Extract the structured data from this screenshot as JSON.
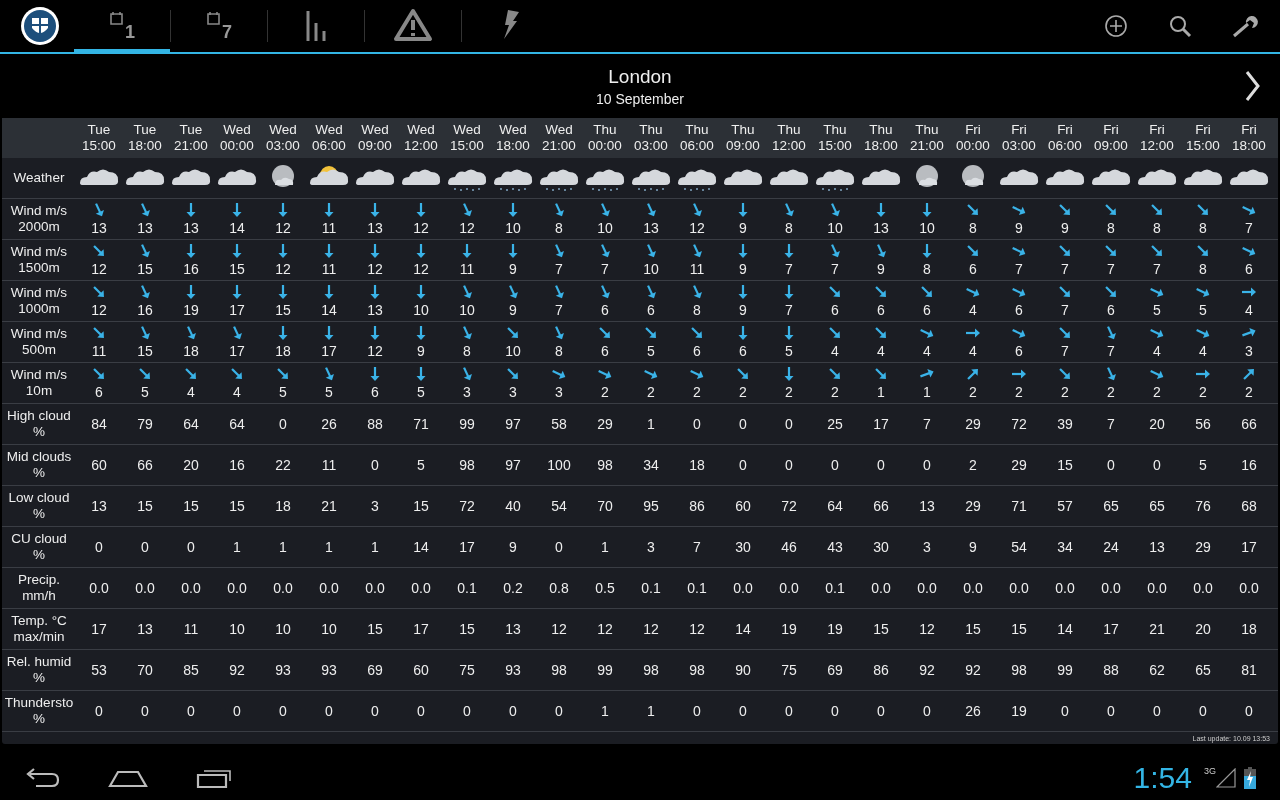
{
  "tabs": [
    {
      "kind": "day",
      "label": "1",
      "selected": true
    },
    {
      "kind": "day",
      "label": "7",
      "selected": false
    },
    {
      "kind": "chart",
      "selected": false
    },
    {
      "kind": "warning",
      "selected": false
    },
    {
      "kind": "lightning",
      "selected": false
    }
  ],
  "location": {
    "city": "London",
    "date": "10 September"
  },
  "columns": [
    {
      "day": "Tue",
      "time": "15:00"
    },
    {
      "day": "Tue",
      "time": "18:00"
    },
    {
      "day": "Tue",
      "time": "21:00"
    },
    {
      "day": "Wed",
      "time": "00:00"
    },
    {
      "day": "Wed",
      "time": "03:00"
    },
    {
      "day": "Wed",
      "time": "06:00"
    },
    {
      "day": "Wed",
      "time": "09:00"
    },
    {
      "day": "Wed",
      "time": "12:00"
    },
    {
      "day": "Wed",
      "time": "15:00"
    },
    {
      "day": "Wed",
      "time": "18:00"
    },
    {
      "day": "Wed",
      "time": "21:00"
    },
    {
      "day": "Thu",
      "time": "00:00"
    },
    {
      "day": "Thu",
      "time": "03:00"
    },
    {
      "day": "Thu",
      "time": "06:00"
    },
    {
      "day": "Thu",
      "time": "09:00"
    },
    {
      "day": "Thu",
      "time": "12:00"
    },
    {
      "day": "Thu",
      "time": "15:00"
    },
    {
      "day": "Thu",
      "time": "18:00"
    },
    {
      "day": "Thu",
      "time": "21:00"
    },
    {
      "day": "Fri",
      "time": "00:00"
    },
    {
      "day": "Fri",
      "time": "03:00"
    },
    {
      "day": "Fri",
      "time": "06:00"
    },
    {
      "day": "Fri",
      "time": "09:00"
    },
    {
      "day": "Fri",
      "time": "12:00"
    },
    {
      "day": "Fri",
      "time": "15:00"
    },
    {
      "day": "Fri",
      "time": "18:00"
    }
  ],
  "rows": [
    {
      "kind": "weather",
      "label": [
        "Weather"
      ],
      "cells": [
        {
          "kind": "cloudy"
        },
        {
          "kind": "cloudy"
        },
        {
          "kind": "cloudy"
        },
        {
          "kind": "cloudy"
        },
        {
          "kind": "night"
        },
        {
          "kind": "sun"
        },
        {
          "kind": "cloudy"
        },
        {
          "kind": "cloudy"
        },
        {
          "kind": "rain"
        },
        {
          "kind": "rain"
        },
        {
          "kind": "rain"
        },
        {
          "kind": "rain"
        },
        {
          "kind": "rain"
        },
        {
          "kind": "rain"
        },
        {
          "kind": "cloudy"
        },
        {
          "kind": "cloudy"
        },
        {
          "kind": "rain"
        },
        {
          "kind": "cloudy"
        },
        {
          "kind": "night"
        },
        {
          "kind": "night"
        },
        {
          "kind": "cloudy"
        },
        {
          "kind": "cloudy"
        },
        {
          "kind": "cloudy"
        },
        {
          "kind": "cloudy"
        },
        {
          "kind": "cloudy"
        },
        {
          "kind": "cloudy"
        }
      ]
    },
    {
      "kind": "wind",
      "label": [
        "Wind m/s",
        "2000m"
      ],
      "cells": [
        {
          "kind": "sse",
          "value": "13"
        },
        {
          "kind": "sse",
          "value": "13"
        },
        {
          "kind": "s",
          "value": "13"
        },
        {
          "kind": "s",
          "value": "14"
        },
        {
          "kind": "s",
          "value": "12"
        },
        {
          "kind": "s",
          "value": "11"
        },
        {
          "kind": "s",
          "value": "13"
        },
        {
          "kind": "s",
          "value": "12"
        },
        {
          "kind": "sse",
          "value": "12"
        },
        {
          "kind": "s",
          "value": "10"
        },
        {
          "kind": "sse",
          "value": "8"
        },
        {
          "kind": "sse",
          "value": "10"
        },
        {
          "kind": "sse",
          "value": "13"
        },
        {
          "kind": "sse",
          "value": "12"
        },
        {
          "kind": "s",
          "value": "9"
        },
        {
          "kind": "sse",
          "value": "8"
        },
        {
          "kind": "sse",
          "value": "10"
        },
        {
          "kind": "s",
          "value": "13"
        },
        {
          "kind": "s",
          "value": "10"
        },
        {
          "kind": "se",
          "value": "8"
        },
        {
          "kind": "ese",
          "value": "9"
        },
        {
          "kind": "se",
          "value": "9"
        },
        {
          "kind": "se",
          "value": "8"
        },
        {
          "kind": "se",
          "value": "8"
        },
        {
          "kind": "se",
          "value": "8"
        },
        {
          "kind": "ese",
          "value": "7"
        }
      ]
    },
    {
      "kind": "wind",
      "label": [
        "Wind m/s",
        "1500m"
      ],
      "cells": [
        {
          "kind": "se",
          "value": "12"
        },
        {
          "kind": "sse",
          "value": "15"
        },
        {
          "kind": "s",
          "value": "16"
        },
        {
          "kind": "s",
          "value": "15"
        },
        {
          "kind": "s",
          "value": "12"
        },
        {
          "kind": "s",
          "value": "11"
        },
        {
          "kind": "s",
          "value": "12"
        },
        {
          "kind": "s",
          "value": "12"
        },
        {
          "kind": "s",
          "value": "11"
        },
        {
          "kind": "s",
          "value": "9"
        },
        {
          "kind": "sse",
          "value": "7"
        },
        {
          "kind": "sse",
          "value": "7"
        },
        {
          "kind": "sse",
          "value": "10"
        },
        {
          "kind": "sse",
          "value": "11"
        },
        {
          "kind": "s",
          "value": "9"
        },
        {
          "kind": "s",
          "value": "7"
        },
        {
          "kind": "sse",
          "value": "7"
        },
        {
          "kind": "sse",
          "value": "9"
        },
        {
          "kind": "s",
          "value": "8"
        },
        {
          "kind": "se",
          "value": "6"
        },
        {
          "kind": "ese",
          "value": "7"
        },
        {
          "kind": "se",
          "value": "7"
        },
        {
          "kind": "se",
          "value": "7"
        },
        {
          "kind": "se",
          "value": "7"
        },
        {
          "kind": "se",
          "value": "8"
        },
        {
          "kind": "ese",
          "value": "6"
        }
      ]
    },
    {
      "kind": "wind",
      "label": [
        "Wind m/s",
        "1000m"
      ],
      "cells": [
        {
          "kind": "se",
          "value": "12"
        },
        {
          "kind": "sse",
          "value": "16"
        },
        {
          "kind": "s",
          "value": "19"
        },
        {
          "kind": "s",
          "value": "17"
        },
        {
          "kind": "s",
          "value": "15"
        },
        {
          "kind": "s",
          "value": "14"
        },
        {
          "kind": "s",
          "value": "13"
        },
        {
          "kind": "s",
          "value": "10"
        },
        {
          "kind": "sse",
          "value": "10"
        },
        {
          "kind": "sse",
          "value": "9"
        },
        {
          "kind": "sse",
          "value": "7"
        },
        {
          "kind": "sse",
          "value": "6"
        },
        {
          "kind": "sse",
          "value": "6"
        },
        {
          "kind": "sse",
          "value": "8"
        },
        {
          "kind": "s",
          "value": "9"
        },
        {
          "kind": "s",
          "value": "7"
        },
        {
          "kind": "se",
          "value": "6"
        },
        {
          "kind": "se",
          "value": "6"
        },
        {
          "kind": "se",
          "value": "6"
        },
        {
          "kind": "ese",
          "value": "4"
        },
        {
          "kind": "ese",
          "value": "6"
        },
        {
          "kind": "se",
          "value": "7"
        },
        {
          "kind": "se",
          "value": "6"
        },
        {
          "kind": "ese",
          "value": "5"
        },
        {
          "kind": "ese",
          "value": "5"
        },
        {
          "kind": "e",
          "value": "4"
        }
      ]
    },
    {
      "kind": "wind",
      "label": [
        "Wind m/s",
        "500m"
      ],
      "cells": [
        {
          "kind": "se",
          "value": "11"
        },
        {
          "kind": "sse",
          "value": "15"
        },
        {
          "kind": "sse",
          "value": "18"
        },
        {
          "kind": "sse",
          "value": "17"
        },
        {
          "kind": "s",
          "value": "18"
        },
        {
          "kind": "s",
          "value": "17"
        },
        {
          "kind": "s",
          "value": "12"
        },
        {
          "kind": "s",
          "value": "9"
        },
        {
          "kind": "sse",
          "value": "8"
        },
        {
          "kind": "se",
          "value": "10"
        },
        {
          "kind": "sse",
          "value": "8"
        },
        {
          "kind": "se",
          "value": "6"
        },
        {
          "kind": "se",
          "value": "5"
        },
        {
          "kind": "se",
          "value": "6"
        },
        {
          "kind": "s",
          "value": "6"
        },
        {
          "kind": "s",
          "value": "5"
        },
        {
          "kind": "se",
          "value": "4"
        },
        {
          "kind": "se",
          "value": "4"
        },
        {
          "kind": "ese",
          "value": "4"
        },
        {
          "kind": "e",
          "value": "4"
        },
        {
          "kind": "ese",
          "value": "6"
        },
        {
          "kind": "se",
          "value": "7"
        },
        {
          "kind": "sse",
          "value": "7"
        },
        {
          "kind": "ese",
          "value": "4"
        },
        {
          "kind": "ese",
          "value": "4"
        },
        {
          "kind": "ene",
          "value": "3"
        }
      ]
    },
    {
      "kind": "wind",
      "label": [
        "Wind m/s",
        "10m"
      ],
      "cells": [
        {
          "kind": "se",
          "value": "6"
        },
        {
          "kind": "se",
          "value": "5"
        },
        {
          "kind": "se",
          "value": "4"
        },
        {
          "kind": "se",
          "value": "4"
        },
        {
          "kind": "se",
          "value": "5"
        },
        {
          "kind": "sse",
          "value": "5"
        },
        {
          "kind": "s",
          "value": "6"
        },
        {
          "kind": "s",
          "value": "5"
        },
        {
          "kind": "sse",
          "value": "3"
        },
        {
          "kind": "se",
          "value": "3"
        },
        {
          "kind": "ese",
          "value": "3"
        },
        {
          "kind": "ese",
          "value": "2"
        },
        {
          "kind": "ese",
          "value": "2"
        },
        {
          "kind": "ese",
          "value": "2"
        },
        {
          "kind": "se",
          "value": "2"
        },
        {
          "kind": "s",
          "value": "2"
        },
        {
          "kind": "se",
          "value": "2"
        },
        {
          "kind": "se",
          "value": "1"
        },
        {
          "kind": "ene",
          "value": "1"
        },
        {
          "kind": "ne",
          "value": "2"
        },
        {
          "kind": "e",
          "value": "2"
        },
        {
          "kind": "se",
          "value": "2"
        },
        {
          "kind": "sse",
          "value": "2"
        },
        {
          "kind": "ese",
          "value": "2"
        },
        {
          "kind": "e",
          "value": "2"
        },
        {
          "kind": "ne",
          "value": "2"
        }
      ]
    },
    {
      "kind": "value",
      "label": [
        "High cloud",
        "%"
      ],
      "cells": [
        "84",
        "79",
        "64",
        "64",
        "0",
        "26",
        "88",
        "71",
        "99",
        "97",
        "58",
        "29",
        "1",
        "0",
        "0",
        "0",
        "25",
        "17",
        "7",
        "29",
        "72",
        "39",
        "7",
        "20",
        "56",
        "66"
      ]
    },
    {
      "kind": "value",
      "label": [
        "Mid clouds",
        "%"
      ],
      "cells": [
        "60",
        "66",
        "20",
        "16",
        "22",
        "11",
        "0",
        "5",
        "98",
        "97",
        "100",
        "98",
        "34",
        "18",
        "0",
        "0",
        "0",
        "0",
        "0",
        "2",
        "29",
        "15",
        "0",
        "0",
        "5",
        "16"
      ]
    },
    {
      "kind": "value",
      "label": [
        "Low cloud",
        "%"
      ],
      "cells": [
        "13",
        "15",
        "15",
        "15",
        "18",
        "21",
        "3",
        "15",
        "72",
        "40",
        "54",
        "70",
        "95",
        "86",
        "60",
        "72",
        "64",
        "66",
        "13",
        "29",
        "71",
        "57",
        "65",
        "65",
        "76",
        "68"
      ]
    },
    {
      "kind": "value",
      "label": [
        "CU cloud",
        "%"
      ],
      "cells": [
        "0",
        "0",
        "0",
        "1",
        "1",
        "1",
        "1",
        "14",
        "17",
        "9",
        "0",
        "1",
        "3",
        "7",
        "30",
        "46",
        "43",
        "30",
        "3",
        "9",
        "54",
        "34",
        "24",
        "13",
        "29",
        "17"
      ]
    },
    {
      "kind": "value",
      "label": [
        "Precip.",
        "mm/h"
      ],
      "cells": [
        "0.0",
        "0.0",
        "0.0",
        "0.0",
        "0.0",
        "0.0",
        "0.0",
        "0.0",
        "0.1",
        "0.2",
        "0.8",
        "0.5",
        "0.1",
        "0.1",
        "0.0",
        "0.0",
        "0.1",
        "0.0",
        "0.0",
        "0.0",
        "0.0",
        "0.0",
        "0.0",
        "0.0",
        "0.0",
        "0.0"
      ]
    },
    {
      "kind": "value",
      "label": [
        "Temp. °C",
        "max/min"
      ],
      "cells": [
        "17",
        "13",
        "11",
        "10",
        "10",
        "10",
        "15",
        "17",
        "15",
        "13",
        "12",
        "12",
        "12",
        "12",
        "14",
        "19",
        "19",
        "15",
        "12",
        "15",
        "15",
        "14",
        "17",
        "21",
        "20",
        "18"
      ]
    },
    {
      "kind": "value",
      "label": [
        "Rel. humid",
        "%"
      ],
      "cells": [
        "53",
        "70",
        "85",
        "92",
        "93",
        "93",
        "69",
        "60",
        "75",
        "93",
        "98",
        "99",
        "98",
        "98",
        "90",
        "75",
        "69",
        "86",
        "92",
        "92",
        "98",
        "99",
        "88",
        "62",
        "65",
        "81"
      ]
    },
    {
      "kind": "value",
      "label": [
        "Thundersto",
        "%"
      ],
      "cells": [
        "0",
        "0",
        "0",
        "0",
        "0",
        "0",
        "0",
        "0",
        "0",
        "0",
        "0",
        "1",
        "1",
        "0",
        "0",
        "0",
        "0",
        "0",
        "0",
        "26",
        "19",
        "0",
        "0",
        "0",
        "0",
        "0"
      ]
    }
  ],
  "last_update": "Last update: 10.09 13:53",
  "status_bar": {
    "time": "1:54",
    "network": "3G"
  }
}
